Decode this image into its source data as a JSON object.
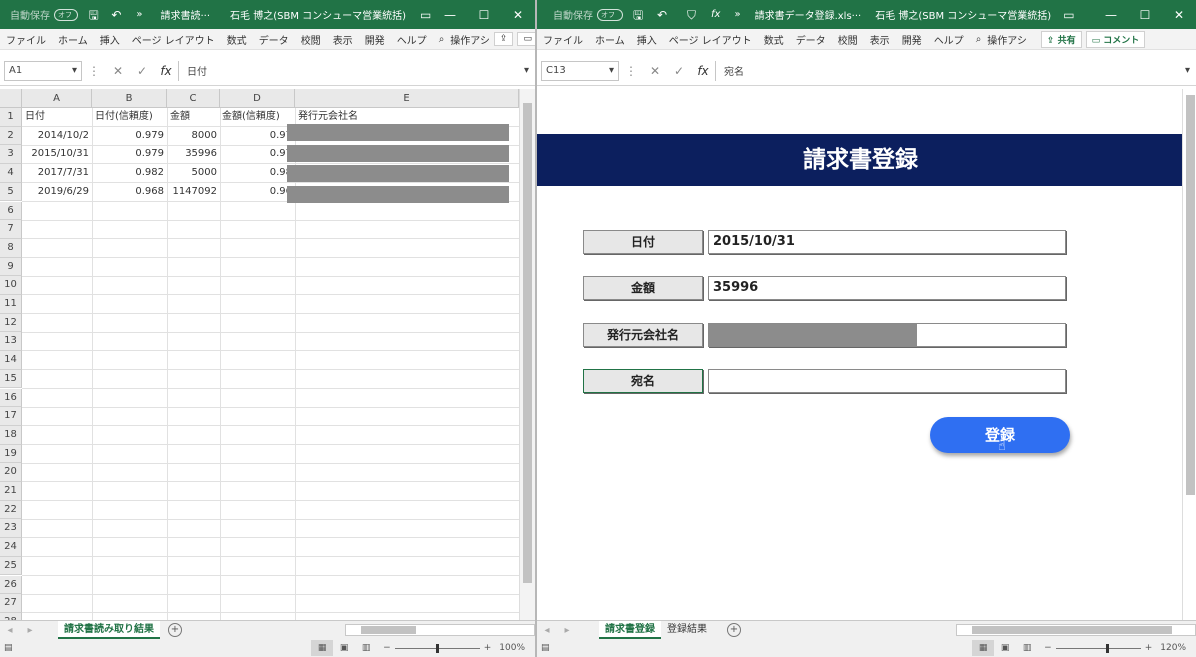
{
  "left_window": {
    "titlebar": {
      "autosave": "自動保存",
      "autosave_state": "オフ",
      "filename": "請求書読···",
      "user": "石毛 博之(SBM コンシューマ営業統括)"
    },
    "ribbon_tabs": [
      "ファイル",
      "ホーム",
      "挿入",
      "ページ レイアウト",
      "数式",
      "データ",
      "校閲",
      "表示",
      "開発",
      "ヘルプ"
    ],
    "tell_me": "操作アシ",
    "name_box": "A1",
    "formula_value": "日付",
    "columns": [
      "A",
      "B",
      "C",
      "D",
      "E"
    ],
    "row_numbers": [
      "1",
      "2",
      "3",
      "4",
      "5",
      "6",
      "7",
      "8",
      "9",
      "10",
      "11",
      "12",
      "13",
      "14",
      "15",
      "16",
      "17",
      "18",
      "19",
      "20",
      "21",
      "22",
      "23",
      "24",
      "25",
      "26",
      "27",
      "28"
    ],
    "headers": [
      "日付",
      "日付(信頼度)",
      "金額",
      "金額(信頼度)",
      "発行元会社名"
    ],
    "rows": [
      [
        "2014/10/2",
        "0.979",
        "8000",
        "0.97"
      ],
      [
        "2015/10/31",
        "0.979",
        "35996",
        "0.97"
      ],
      [
        "2017/7/31",
        "0.982",
        "5000",
        "0.98"
      ],
      [
        "2019/6/29",
        "0.968",
        "1147092",
        "0.96"
      ]
    ],
    "sheet_tab": "請求書読み取り結果",
    "zoom": "100%"
  },
  "right_window": {
    "titlebar": {
      "autosave": "自動保存",
      "autosave_state": "オフ",
      "filename": "請求書データ登録.xls···",
      "user": "石毛 博之(SBM コンシューマ営業統括)"
    },
    "ribbon_tabs": [
      "ファイル",
      "ホーム",
      "挿入",
      "ページ レイアウト",
      "数式",
      "データ",
      "校閲",
      "表示",
      "開発",
      "ヘルプ"
    ],
    "tell_me": "操作アシ",
    "share_label": "共有",
    "comment_label": "コメント",
    "name_box": "C13",
    "formula_value": "宛名",
    "form": {
      "title": "請求書登録",
      "date_label": "日付",
      "date_value": "2015/10/31",
      "amount_label": "金額",
      "amount_value": "35996",
      "company_label": "発行元会社名",
      "recipient_label": "宛名",
      "recipient_value": "",
      "register_button": "登録"
    },
    "sheet_tabs": [
      "請求書登録",
      "登録結果"
    ],
    "zoom": "120%"
  },
  "colors": {
    "excel_green": "#217346",
    "banner_navy": "#0c1f5e",
    "button_blue": "#2f6ff2",
    "redaction_gray": "#8c8c8c"
  },
  "icons": [
    "save-icon",
    "undo-icon",
    "filter-icon",
    "fx-icon",
    "search-icon",
    "share-icon",
    "comment-icon",
    "add-sheet-icon"
  ]
}
